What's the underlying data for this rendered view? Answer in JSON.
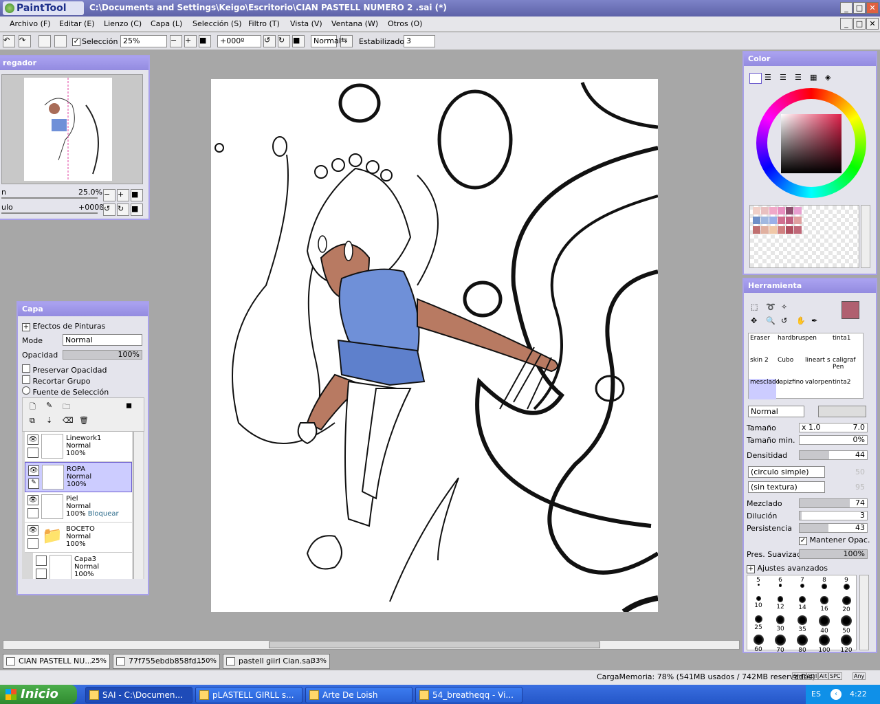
{
  "app": {
    "logo": "PaintTool SAI",
    "title": "C:\\Documents and Settings\\Keigo\\Escritorio\\CIAN PASTELL NUMERO 2 .sai (*)"
  },
  "menu": [
    "Archivo (F)",
    "Editar (E)",
    "Lienzo (C)",
    "Capa (L)",
    "Selección (S)",
    "Filtro (T)",
    "Vista (V)",
    "Ventana (W)",
    "Otros (O)"
  ],
  "toolbar": {
    "selection_label": "Selección",
    "zoom": "25%",
    "rotation": "+000º",
    "blend": "Normal",
    "stabilizer_label": "Estabilizador",
    "stabilizer": "3"
  },
  "navigator": {
    "title": "regador",
    "zoom_label": "n",
    "zoom_value": "25.0%",
    "angle_label": "ulo",
    "angle_value": "+000ß"
  },
  "layers": {
    "title": "Capa",
    "effects": "Efectos de Pinturas",
    "mode_label": "Mode",
    "mode": "Normal",
    "opacity_label": "Opacidad",
    "opacity": "100%",
    "preserve": "Preservar Opacidad",
    "clip": "Recortar Grupo",
    "selsource": "Fuente de Selección",
    "items": [
      {
        "name": "Linework1",
        "mode": "Normal",
        "opacity": "100%",
        "extra": ""
      },
      {
        "name": "ROPA",
        "mode": "Normal",
        "opacity": "100%",
        "extra": ""
      },
      {
        "name": "Piel",
        "mode": "Normal",
        "opacity": "100%",
        "extra": "Bloquear"
      },
      {
        "name": "BOCETO",
        "mode": "Normal",
        "opacity": "100%",
        "extra": ""
      },
      {
        "name": "Capa3",
        "mode": "Normal",
        "opacity": "100%",
        "extra": ""
      }
    ]
  },
  "color": {
    "title": "Color",
    "swatches": [
      "#f0d0c8",
      "#e8c0c0",
      "#f0a8c8",
      "#e890c0",
      "#905070",
      "#e8a0d0",
      "#7090c8",
      "#a0b8e0",
      "#9ab0e8",
      "#d07090",
      "#c06080",
      "#e0a0a0",
      "#c07070",
      "#e0b0a0",
      "#f0c8a8",
      "#d08080",
      "#b05060",
      "#c06878"
    ]
  },
  "tools": {
    "title": "Herramienta",
    "brushes": [
      "Eraser",
      "hardbrus",
      "pen",
      "tinta1",
      "skin 2",
      "Cubo",
      "lineart s",
      "caligraf Pen",
      "mesclado",
      "lapizfino",
      "valorpen",
      "tinta2"
    ],
    "blend": "Normal",
    "size_label": "Tamaño",
    "size_mult": "x 1.0",
    "size": "7.0",
    "minsize_label": "Tamaño min.",
    "minsize": "0%",
    "density_label": "Densitidad",
    "density": "44",
    "shape": "(circulo simple)",
    "shape_val": "50",
    "texture": "(sin textura)",
    "texture_val": "95",
    "blend_label": "Mezclado",
    "blend_val": "74",
    "dilution_label": "Dilución",
    "dilution": "3",
    "persist_label": "Persistencia",
    "persist": "43",
    "keep_opacity": "Mantener Opac.",
    "smooth_label": "Pres. Suavizado",
    "smooth": "100%",
    "advanced": "Ajustes avanzados",
    "size_row1": [
      "5",
      "6",
      "7",
      "8",
      "9"
    ],
    "size_row2": [
      "10",
      "12",
      "14",
      "16",
      "20"
    ],
    "size_row3": [
      "25",
      "30",
      "35",
      "40",
      "50"
    ],
    "size_row4": [
      "60",
      "70",
      "80",
      "100",
      "120"
    ]
  },
  "docs": [
    {
      "name": "CIAN PASTELL NU...",
      "zoom": "25%"
    },
    {
      "name": "77f755ebdb858fd...",
      "zoom": "150%"
    },
    {
      "name": "pastell giirl Cian.sai",
      "zoom": "33%"
    }
  ],
  "status": {
    "memory": "CargaMemoria: 78% (541MB usados / 742MB reservados)",
    "keys": [
      "Shift",
      "Ctrl",
      "Alt",
      "SPC",
      "Any"
    ]
  },
  "taskbar": {
    "start": "Inicio",
    "tasks": [
      "SAI - C:\\Documen...",
      "pLASTELL GIRLL s...",
      "Arte De Loish",
      "54_breatheqq - Vi..."
    ],
    "lang": "ES",
    "clock": "4:22"
  }
}
